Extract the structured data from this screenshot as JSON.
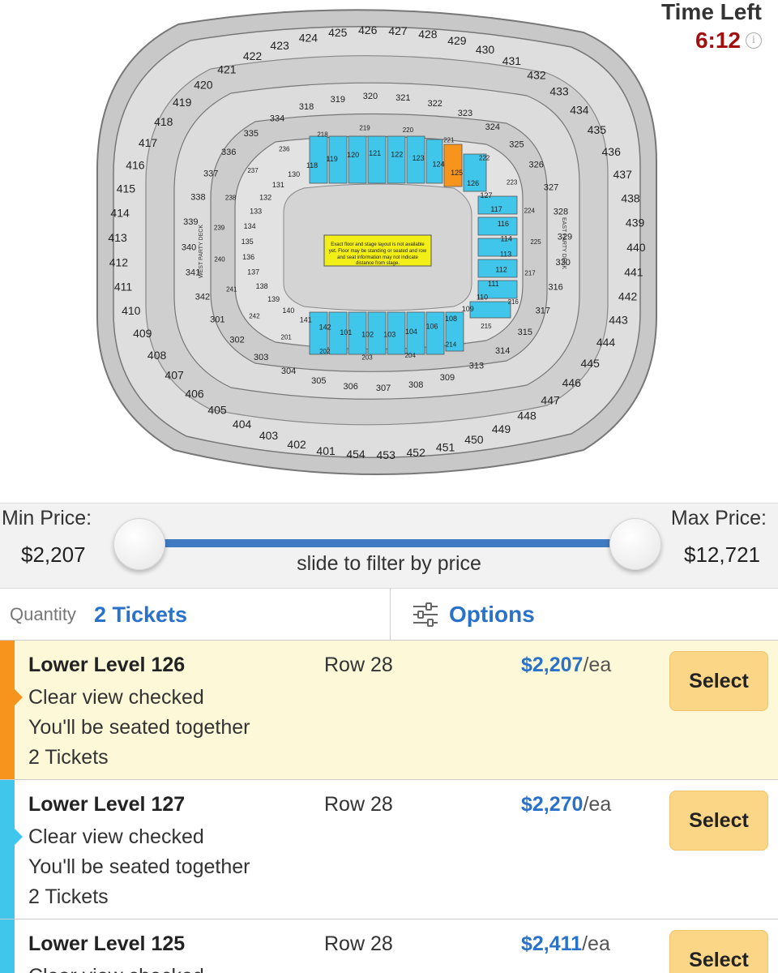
{
  "timer": {
    "label": "Time Left",
    "value": "6:12",
    "info_icon": "info-icon"
  },
  "map": {
    "stage_note": "Exact floor and stage layout is not available yet. Floor may be standing or seated and row and seat information may not indicate distance from stage.",
    "deck_labels": [
      "WEST PARTY DECK",
      "EAST PARTY DECK"
    ],
    "highlight_color": "#3fc6ea",
    "selected_color": "#f7941d",
    "sections_400": [
      "423",
      "424",
      "425",
      "426",
      "427",
      "428",
      "429",
      "430",
      "431",
      "432",
      "433",
      "434",
      "435",
      "436",
      "437",
      "438",
      "439",
      "440",
      "441",
      "442",
      "443",
      "444",
      "445",
      "446",
      "447",
      "448",
      "449",
      "450",
      "451",
      "452",
      "453",
      "454",
      "401",
      "402",
      "403",
      "404",
      "405",
      "406",
      "407",
      "408",
      "409",
      "410",
      "411",
      "412",
      "413",
      "414",
      "415",
      "416",
      "417",
      "418",
      "419",
      "420",
      "421",
      "422"
    ],
    "sections_300": [
      "318",
      "319",
      "320",
      "321",
      "322",
      "323",
      "324",
      "325",
      "326",
      "327",
      "328",
      "329",
      "330",
      "316",
      "317",
      "315",
      "314",
      "313",
      "309",
      "308",
      "307",
      "306",
      "305",
      "304",
      "303",
      "302",
      "301",
      "342",
      "341",
      "340",
      "339",
      "338",
      "337",
      "336",
      "335",
      "334"
    ],
    "sections_200": [
      "218",
      "219",
      "220",
      "221",
      "222",
      "223",
      "224",
      "225",
      "217",
      "216",
      "215",
      "214",
      "204",
      "203",
      "202",
      "201",
      "242",
      "241",
      "240",
      "239",
      "238",
      "237",
      "236"
    ],
    "sections_100": [
      "118",
      "119",
      "120",
      "121",
      "122",
      "123",
      "124",
      "125",
      "126",
      "127",
      "117",
      "116",
      "114",
      "113",
      "112",
      "111",
      "110",
      "109",
      "108",
      "106",
      "104",
      "103",
      "102",
      "101",
      "142",
      "141",
      "140",
      "139",
      "138",
      "137",
      "136",
      "135",
      "134",
      "133",
      "132",
      "131",
      "130"
    ]
  },
  "price_filter": {
    "min_label": "Min Price:",
    "min_value": "$2,207",
    "max_label": "Max Price:",
    "max_value": "$12,721",
    "hint": "slide to filter by price"
  },
  "toolbar": {
    "quantity_label": "Quantity",
    "quantity_value": "2 Tickets",
    "options_label": "Options"
  },
  "listings": [
    {
      "section": "Lower Level 126",
      "view": "Clear view checked",
      "seating": "You'll be seated together",
      "qty": "2 Tickets",
      "row": "Row 28",
      "price": "$2,207",
      "unit": "/ea",
      "button": "Select",
      "color": "#f7941d"
    },
    {
      "section": "Lower Level 127",
      "view": "Clear view checked",
      "seating": "You'll be seated together",
      "qty": "2 Tickets",
      "row": "Row 28",
      "price": "$2,270",
      "unit": "/ea",
      "button": "Select",
      "color": "#3fc6ea"
    },
    {
      "section": "Lower Level 125",
      "view": "Clear view checked",
      "seating": "",
      "qty": "",
      "row": "Row 28",
      "price": "$2,411",
      "unit": "/ea",
      "button": "Select",
      "color": "#3fc6ea"
    }
  ]
}
